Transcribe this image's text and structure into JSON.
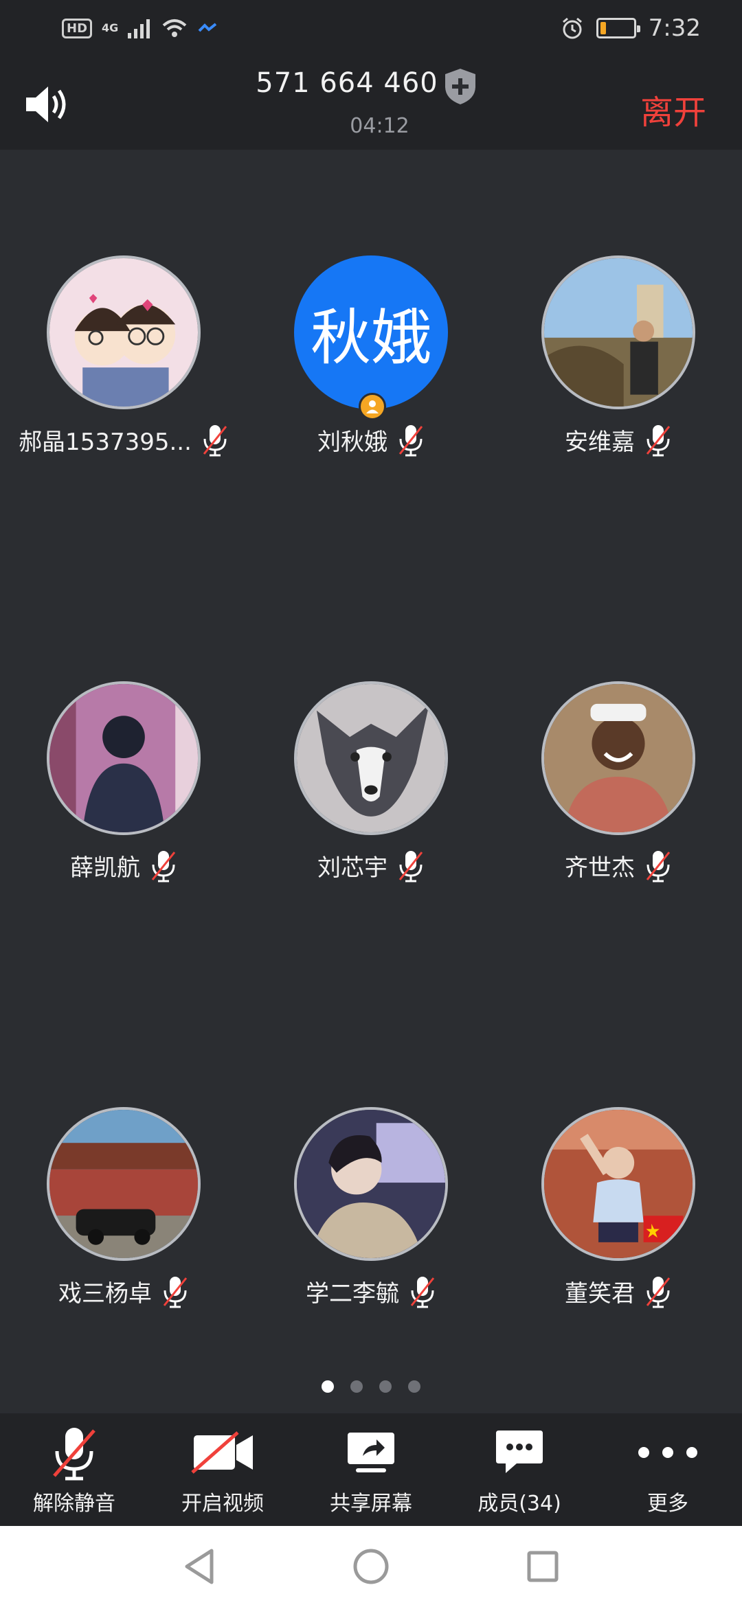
{
  "status_bar": {
    "hd": "HD",
    "network": "4G",
    "time": "7:32",
    "battery_level": 0.18
  },
  "header": {
    "meeting_id": "571 664 460",
    "timer": "04:12",
    "leave_label": "离开"
  },
  "participants": [
    {
      "name": "郝晶1537395...",
      "avatar": "photo",
      "muted": true
    },
    {
      "name": "刘秋娥",
      "avatar_text": "秋娥",
      "avatar": "text",
      "host": true,
      "muted": true
    },
    {
      "name": "安维嘉",
      "avatar": "photo",
      "muted": true
    },
    {
      "name": "薛凯航",
      "avatar": "photo",
      "muted": true
    },
    {
      "name": "刘芯宇",
      "avatar": "photo",
      "muted": true
    },
    {
      "name": "齐世杰",
      "avatar": "photo",
      "muted": true
    },
    {
      "name": "戏三杨卓",
      "avatar": "photo",
      "muted": true
    },
    {
      "name": "学二李毓",
      "avatar": "photo",
      "muted": true
    },
    {
      "name": "董笑君",
      "avatar": "photo",
      "muted": true
    }
  ],
  "pagination": {
    "pages": 4,
    "current": 1
  },
  "toolbar": {
    "unmute_label": "解除静音",
    "video_label": "开启视频",
    "share_label": "共享屏幕",
    "members_label": "成员(34)",
    "more_label": "更多"
  },
  "colors": {
    "background": "#2b2d31",
    "bar": "#222326",
    "accent_blue": "#1677f5",
    "leave_red": "#f0413b",
    "host_badge": "#f5a623"
  }
}
